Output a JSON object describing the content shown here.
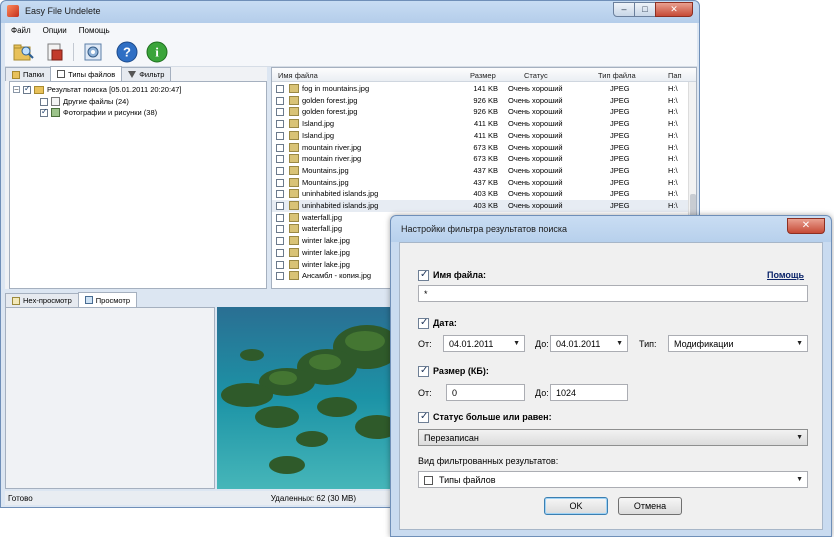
{
  "window": {
    "title": "Easy File Undelete",
    "controls": {
      "minimize": "–",
      "maximize": "□",
      "close": "✕"
    }
  },
  "menu": [
    "Файл",
    "Опции",
    "Помощь"
  ],
  "left_tabs": [
    "Папки",
    "Типы файлов",
    "Фильтр"
  ],
  "tree": {
    "root": "Результат поиска [05.01.2011 20:20:47]",
    "children": [
      "Другие файлы (24)",
      "Фотографии и рисунки (38)"
    ]
  },
  "file_list": {
    "columns": [
      "Имя файла",
      "Размер",
      "Статус",
      "Тип файла",
      "Пап"
    ],
    "rows": [
      {
        "name": "fog in mountains.jpg",
        "size": "141 KB",
        "status": "Очень хороший",
        "type": "JPEG",
        "folder": "H:\\"
      },
      {
        "name": "golden forest.jpg",
        "size": "926 KB",
        "status": "Очень хороший",
        "type": "JPEG",
        "folder": "H:\\"
      },
      {
        "name": "golden forest.jpg",
        "size": "926 KB",
        "status": "Очень хороший",
        "type": "JPEG",
        "folder": "H:\\"
      },
      {
        "name": "Island.jpg",
        "size": "411 KB",
        "status": "Очень хороший",
        "type": "JPEG",
        "folder": "H:\\"
      },
      {
        "name": "Island.jpg",
        "size": "411 KB",
        "status": "Очень хороший",
        "type": "JPEG",
        "folder": "H:\\"
      },
      {
        "name": "mountain river.jpg",
        "size": "673 KB",
        "status": "Очень хороший",
        "type": "JPEG",
        "folder": "H:\\"
      },
      {
        "name": "mountain river.jpg",
        "size": "673 KB",
        "status": "Очень хороший",
        "type": "JPEG",
        "folder": "H:\\"
      },
      {
        "name": "Mountains.jpg",
        "size": "437 KB",
        "status": "Очень хороший",
        "type": "JPEG",
        "folder": "H:\\"
      },
      {
        "name": "Mountains.jpg",
        "size": "437 KB",
        "status": "Очень хороший",
        "type": "JPEG",
        "folder": "H:\\"
      },
      {
        "name": "uninhabited islands.jpg",
        "size": "403 KB",
        "status": "Очень хороший",
        "type": "JPEG",
        "folder": "H:\\"
      },
      {
        "name": "uninhabited islands.jpg",
        "size": "403 KB",
        "status": "Очень хороший",
        "type": "JPEG",
        "folder": "H:\\"
      },
      {
        "name": "waterfall.jpg",
        "size": "",
        "status": "",
        "type": "",
        "folder": ""
      },
      {
        "name": "waterfall.jpg",
        "size": "",
        "status": "",
        "type": "",
        "folder": ""
      },
      {
        "name": "winter lake.jpg",
        "size": "",
        "status": "",
        "type": "",
        "folder": ""
      },
      {
        "name": "winter lake.jpg",
        "size": "",
        "status": "",
        "type": "",
        "folder": ""
      },
      {
        "name": "winter lake.jpg",
        "size": "",
        "status": "",
        "type": "",
        "folder": ""
      },
      {
        "name": "Ансамбл - копия.jpg",
        "size": "",
        "status": "",
        "type": "",
        "folder": ""
      }
    ],
    "selected_index": 10
  },
  "bottom_tabs": [
    "Hex-просмотр",
    "Просмотр"
  ],
  "status": {
    "left": "Готово",
    "right": "Удаленных: 62 (30 MB)"
  },
  "dialog": {
    "title": "Настройки фильтра результатов поиска",
    "close": "✕",
    "help_link": "Помощь",
    "filename": {
      "label": "Имя файла:",
      "value": "*"
    },
    "date": {
      "label": "Дата:",
      "from_label": "От:",
      "from_value": "04.01.2011",
      "to_label": "До:",
      "to_value": "04.01.2011",
      "type_label": "Тип:",
      "type_value": "Модификации"
    },
    "size": {
      "label": "Размер (КБ):",
      "from_label": "От:",
      "from_value": "0",
      "to_label": "До:",
      "to_value": "1024"
    },
    "status": {
      "label": "Статус больше или равен:",
      "value": "Перезаписан"
    },
    "view": {
      "label": "Вид фильтрованных результатов:",
      "value": "Типы файлов"
    },
    "ok": "OK",
    "cancel": "Отмена"
  }
}
